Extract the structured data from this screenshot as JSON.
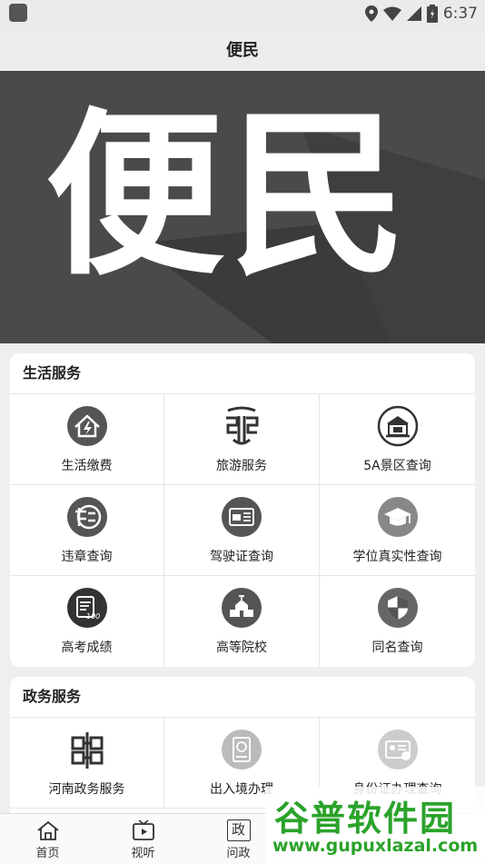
{
  "status": {
    "time": "6:37"
  },
  "header": {
    "title": "便民"
  },
  "banner": {
    "text": "便民"
  },
  "sections": [
    {
      "title": "生活服务",
      "items": [
        {
          "label": "生活缴费",
          "icon": "house-bolt-icon"
        },
        {
          "label": "旅游服务",
          "icon": "travel-logo-icon"
        },
        {
          "label": "5A景区查询",
          "icon": "building-icon"
        },
        {
          "label": "违章查询",
          "icon": "violation-icon"
        },
        {
          "label": "驾驶证查询",
          "icon": "license-card-icon"
        },
        {
          "label": "学位真实性查询",
          "icon": "graduation-cap-icon"
        },
        {
          "label": "高考成绩",
          "icon": "score-sheet-icon"
        },
        {
          "label": "高等院校",
          "icon": "university-icon"
        },
        {
          "label": "同名查询",
          "icon": "shield-icon"
        }
      ]
    },
    {
      "title": "政务服务",
      "items": [
        {
          "label": "河南政务服务",
          "icon": "henan-gov-logo-icon"
        },
        {
          "label": "出入境办理",
          "icon": "passport-icon"
        },
        {
          "label": "身份证办理查询",
          "icon": "id-card-icon"
        }
      ]
    }
  ],
  "tabbar": [
    {
      "label": "首页",
      "icon": "home-icon"
    },
    {
      "label": "视听",
      "icon": "tv-icon"
    },
    {
      "label": "问政",
      "icon": "zheng-icon"
    }
  ],
  "watermark": {
    "line1": "谷普软件园",
    "line2": "www.gupuxlazal.com"
  }
}
